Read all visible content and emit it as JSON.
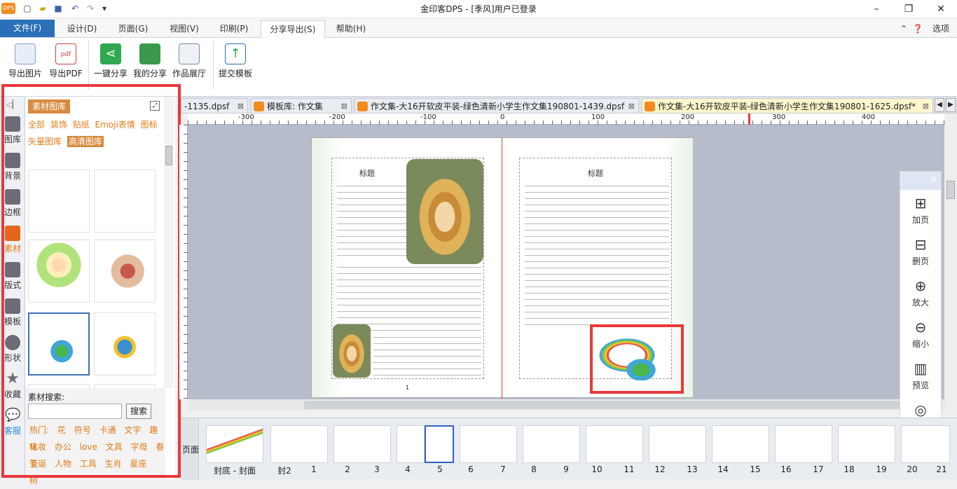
{
  "app": {
    "title": "金印客DPS - [季风]用户已登录",
    "logo": "DPS"
  },
  "menus": [
    "文件(F)",
    "设计(D)",
    "页面(G)",
    "视图(V)",
    "印刷(P)",
    "分享导出(S)",
    "帮助(H)"
  ],
  "menu_right": {
    "options_label": "选项"
  },
  "ribbon": [
    {
      "label": "导出图片",
      "icon": "image-export-icon"
    },
    {
      "label": "导出PDF",
      "icon": "pdf-icon"
    },
    {
      "label": "一键分享",
      "icon": "share-icon"
    },
    {
      "label": "我的分享",
      "icon": "my-share-icon"
    },
    {
      "label": "作品展厅",
      "icon": "gallery-icon"
    },
    {
      "label": "提交模板",
      "icon": "upload-icon"
    }
  ],
  "left_nav": [
    "图库",
    "背景",
    "边框",
    "素材",
    "版式",
    "模板",
    "形状",
    "收藏",
    "客服"
  ],
  "material_panel": {
    "title": "素材图库",
    "categories_row1": [
      "全部",
      "装饰",
      "贴纸",
      "Emoji表情",
      "图标"
    ],
    "categories_row2": [
      "矢量图库",
      "高清图库"
    ],
    "active_category": "高清图库",
    "search_label": "素材搜索:",
    "search_value": "",
    "search_button": "搜索",
    "hot_label": "热门:",
    "hot_tags_row1": [
      "花",
      "符号",
      "卡通",
      "文字",
      "趣味"
    ],
    "hot_tags_row2": [
      "化妆",
      "办公",
      "love",
      "文具",
      "字母",
      "春节"
    ],
    "hot_tags_row3": [
      "圣诞",
      "人物",
      "工具",
      "生肖",
      "星座",
      "树"
    ]
  },
  "doc_tabs": [
    {
      "label": "-1135.dpsf"
    },
    {
      "label": "模板库: 作文集"
    },
    {
      "label": "作文集-大16开软皮平装-绿色清新小学生作文集190801-1439.dpsf"
    },
    {
      "label": "作文集-大16开软皮平装-绿色清新小学生作文集190801-1625.dpsf*"
    }
  ],
  "ruler_labels": [
    "-300",
    "-200",
    "-100",
    "0",
    "100",
    "200",
    "300",
    "400"
  ],
  "page": {
    "left_title": "标题",
    "right_title": "标题",
    "page_number": "1"
  },
  "float_panel": {
    "close": "×",
    "buttons": [
      {
        "label": "加页",
        "icon": "add-page-icon"
      },
      {
        "label": "删页",
        "icon": "delete-page-icon"
      },
      {
        "label": "放大",
        "icon": "zoom-in-icon"
      },
      {
        "label": "缩小",
        "icon": "zoom-out-icon"
      },
      {
        "label": "预览",
        "icon": "preview-icon"
      },
      {
        "label": "分享",
        "icon": "share-chat-icon"
      }
    ]
  },
  "bottom": {
    "side_label": "页面",
    "pages": [
      "封底 - 封面",
      "封2",
      "1",
      "2",
      "3",
      "4",
      "5",
      "6",
      "7",
      "8",
      "9",
      "10",
      "11",
      "12",
      "13",
      "14",
      "15",
      "16",
      "17",
      "18",
      "19",
      "20",
      "21"
    ],
    "selected_page": "5"
  },
  "colors": {
    "accent": "#2b6fb8",
    "highlight_red": "#e8383b",
    "orange": "#d88a3e"
  }
}
